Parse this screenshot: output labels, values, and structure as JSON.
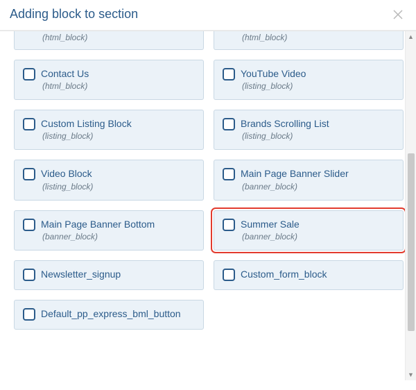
{
  "header": {
    "title": "Adding block to section"
  },
  "blocks": [
    {
      "title": "",
      "type": "(html_block)",
      "partial": true,
      "highlighted": false
    },
    {
      "title": "",
      "type": "(html_block)",
      "partial": true,
      "highlighted": false
    },
    {
      "title": "Contact Us",
      "type": "(html_block)",
      "partial": false,
      "highlighted": false
    },
    {
      "title": "YouTube Video",
      "type": "(listing_block)",
      "partial": false,
      "highlighted": false
    },
    {
      "title": "Custom Listing Block",
      "type": "(listing_block)",
      "partial": false,
      "highlighted": false
    },
    {
      "title": "Brands Scrolling List",
      "type": "(listing_block)",
      "partial": false,
      "highlighted": false
    },
    {
      "title": "Video Block",
      "type": "(listing_block)",
      "partial": false,
      "highlighted": false
    },
    {
      "title": "Main Page Banner Slider",
      "type": "(banner_block)",
      "partial": false,
      "highlighted": false
    },
    {
      "title": "Main Page Banner Bottom",
      "type": "(banner_block)",
      "partial": false,
      "highlighted": false
    },
    {
      "title": "Summer Sale",
      "type": "(banner_block)",
      "partial": false,
      "highlighted": true
    },
    {
      "title": "Newsletter_signup",
      "type": "",
      "partial": false,
      "highlighted": false
    },
    {
      "title": "Custom_form_block",
      "type": "",
      "partial": false,
      "highlighted": false
    },
    {
      "title": "Default_pp_express_bml_button",
      "type": "",
      "partial": false,
      "highlighted": false
    }
  ]
}
